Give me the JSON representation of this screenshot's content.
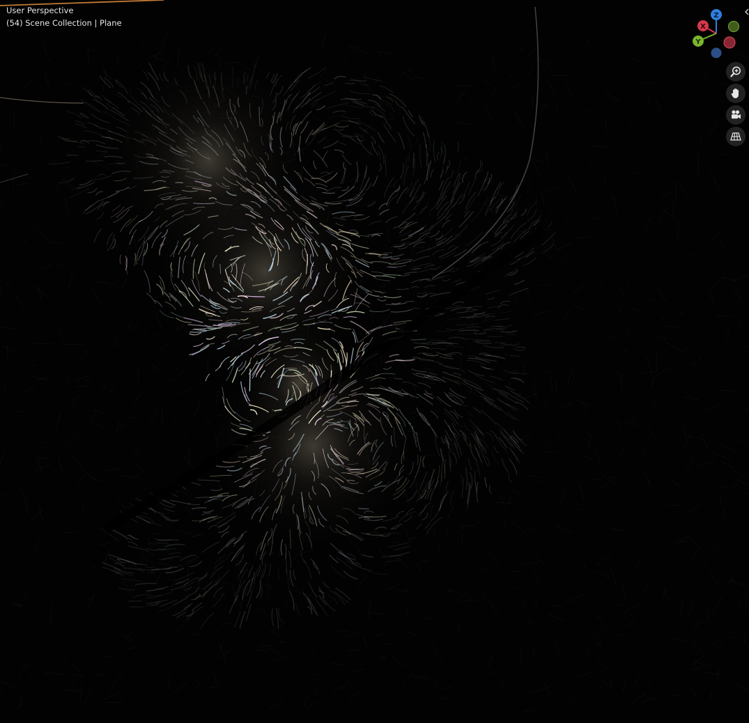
{
  "viewport": {
    "view_name": "User Perspective",
    "collection_info": "(54) Scene Collection | Plane"
  },
  "gizmo": {
    "axes": [
      {
        "label": "Z",
        "color": "#2f7fe0"
      },
      {
        "label": "X",
        "color": "#d8384b"
      },
      {
        "label": "Y",
        "color": "#7ab52f"
      },
      {
        "label": "",
        "color": "#2b4f86"
      },
      {
        "label": "",
        "color": "#8a2633"
      },
      {
        "label": "",
        "color": "#3f5c1c"
      }
    ]
  },
  "nav_icons": [
    "zoom-icon",
    "hand-icon",
    "camera-icon",
    "grid-icon"
  ],
  "colors": {
    "background": "#020202",
    "hair_warm": "#f3e6c6",
    "selection_edge": "#d88a3a"
  }
}
